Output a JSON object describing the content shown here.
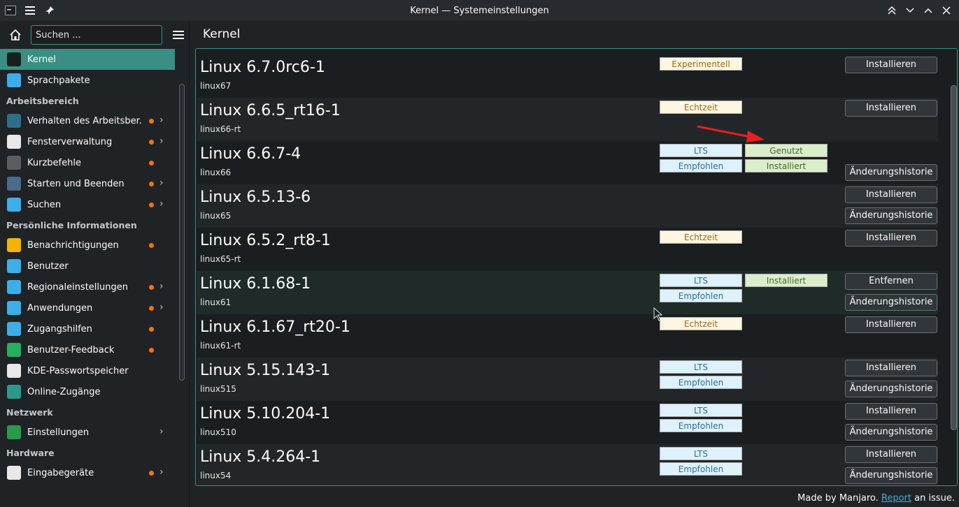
{
  "window": {
    "title": "Kernel — Systemeinstellungen"
  },
  "sidebar": {
    "search_placeholder": "Suchen ...",
    "items_top": [
      {
        "label": "Kernel",
        "icon": "kernel-icon",
        "active": true
      },
      {
        "label": "Sprachpakete",
        "icon": "chat-icon"
      }
    ],
    "sections": [
      {
        "title": "Arbeitsbereich",
        "items": [
          {
            "label": "Verhalten des Arbeitsber...",
            "icon": "desktop-behavior-icon",
            "dot": true,
            "chevron": true
          },
          {
            "label": "Fensterverwaltung",
            "icon": "window-icon",
            "dot": true,
            "chevron": true
          },
          {
            "label": "Kurzbefehle",
            "icon": "keyboard-icon",
            "dot": true
          },
          {
            "label": "Starten und Beenden",
            "icon": "startup-icon",
            "dot": true,
            "chevron": true
          },
          {
            "label": "Suchen",
            "icon": "search-icon",
            "dot": true,
            "chevron": true
          }
        ]
      },
      {
        "title": "Persönliche Informationen",
        "items": [
          {
            "label": "Benachrichtigungen",
            "icon": "bell-icon",
            "dot": true
          },
          {
            "label": "Benutzer",
            "icon": "user-icon"
          },
          {
            "label": "Regionaleinstellungen",
            "icon": "region-icon",
            "dot": true,
            "chevron": true
          },
          {
            "label": "Anwendungen",
            "icon": "apps-icon",
            "dot": true,
            "chevron": true
          },
          {
            "label": "Zugangshilfen",
            "icon": "accessibility-icon",
            "dot": true
          },
          {
            "label": "Benutzer-Feedback",
            "icon": "feedback-icon",
            "dot": true
          },
          {
            "label": "KDE-Passwortspeicher",
            "icon": "wallet-icon"
          },
          {
            "label": "Online-Zugänge",
            "icon": "online-accounts-icon"
          }
        ]
      },
      {
        "title": "Netzwerk",
        "items": [
          {
            "label": "Einstellungen",
            "icon": "globe-icon",
            "chevron": true
          }
        ]
      },
      {
        "title": "Hardware",
        "items": [
          {
            "label": "Eingabegeräte",
            "icon": "mouse-icon",
            "dot": true,
            "chevron": true
          }
        ]
      }
    ]
  },
  "main": {
    "title": "Kernel",
    "kernels": [
      {
        "name": "Linux 6.7.0rc6-1",
        "pkg": "linux67",
        "badges": [
          {
            "text": "Experimentell",
            "type": "exp",
            "col": 0,
            "line": 0
          }
        ],
        "buttons": [
          "Installieren"
        ]
      },
      {
        "name": "Linux 6.6.5_rt16-1",
        "pkg": "linux66-rt",
        "badges": [
          {
            "text": "Echtzeit",
            "type": "rt",
            "col": 0,
            "line": 0
          }
        ],
        "buttons": [
          "Installieren"
        ]
      },
      {
        "name": "Linux 6.6.7-4",
        "pkg": "linux66",
        "badges": [
          {
            "text": "LTS",
            "type": "lts",
            "col": 0,
            "line": 0
          },
          {
            "text": "Genutzt",
            "type": "used",
            "col": 1,
            "line": 0
          },
          {
            "text": "Empfohlen",
            "type": "rec",
            "col": 0,
            "line": 1
          },
          {
            "text": "Installiert",
            "type": "inst",
            "col": 1,
            "line": 1
          }
        ],
        "buttons": [
          "",
          "Änderungshistorie"
        ]
      },
      {
        "name": "Linux 6.5.13-6",
        "pkg": "linux65",
        "badges": [],
        "buttons": [
          "Installieren",
          "Änderungshistorie"
        ]
      },
      {
        "name": "Linux 6.5.2_rt8-1",
        "pkg": "linux65-rt",
        "badges": [
          {
            "text": "Echtzeit",
            "type": "rt",
            "col": 0,
            "line": 0
          }
        ],
        "buttons": [
          "Installieren"
        ]
      },
      {
        "name": "Linux 6.1.68-1",
        "pkg": "linux61",
        "badges": [
          {
            "text": "LTS",
            "type": "lts",
            "col": 0,
            "line": 0
          },
          {
            "text": "Installiert",
            "type": "inst",
            "col": 1,
            "line": 0
          },
          {
            "text": "Empfohlen",
            "type": "rec",
            "col": 0,
            "line": 1
          }
        ],
        "buttons": [
          "Entfernen",
          "Änderungshistorie"
        ]
      },
      {
        "name": "Linux 6.1.67_rt20-1",
        "pkg": "linux61-rt",
        "badges": [
          {
            "text": "Echtzeit",
            "type": "rt",
            "col": 0,
            "line": 0
          }
        ],
        "buttons": [
          "Installieren"
        ]
      },
      {
        "name": "Linux 5.15.143-1",
        "pkg": "linux515",
        "badges": [
          {
            "text": "LTS",
            "type": "lts",
            "col": 0,
            "line": 0
          },
          {
            "text": "Empfohlen",
            "type": "rec",
            "col": 0,
            "line": 1
          }
        ],
        "buttons": [
          "Installieren",
          "Änderungshistorie"
        ]
      },
      {
        "name": "Linux 5.10.204-1",
        "pkg": "linux510",
        "badges": [
          {
            "text": "LTS",
            "type": "lts",
            "col": 0,
            "line": 0
          },
          {
            "text": "Empfohlen",
            "type": "rec",
            "col": 0,
            "line": 1
          }
        ],
        "buttons": [
          "Installieren",
          "Änderungshistorie"
        ]
      },
      {
        "name": "Linux 5.4.264-1",
        "pkg": "linux54",
        "badges": [
          {
            "text": "LTS",
            "type": "lts",
            "col": 0,
            "line": 0
          },
          {
            "text": "Empfohlen",
            "type": "rec",
            "col": 0,
            "line": 1
          }
        ],
        "buttons": [
          "Installieren",
          "Änderungshistorie"
        ]
      }
    ]
  },
  "footer": {
    "prefix": "Made by Manjaro.",
    "link": "Report",
    "suffix": "an issue."
  },
  "colors": {
    "accent": "#3b8e84",
    "dot": "#f67400",
    "link": "#3daee9",
    "annotation_arrow": "#e8201c"
  }
}
